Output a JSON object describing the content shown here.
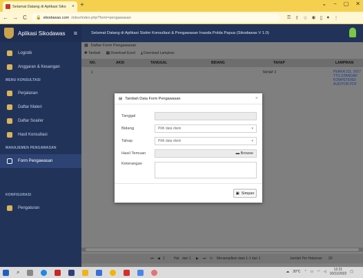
{
  "browser": {
    "tab_title": "Selamat Datang di Aplikasi Siko",
    "tab_close": "×",
    "new_tab": "+",
    "window_controls": [
      "⌄",
      "−",
      "▢",
      "✕"
    ],
    "nav": {
      "back": "←",
      "forward": "→",
      "reload": "C"
    },
    "url_host": "sikodawas.com",
    "url_path": "/sites/index.php?form=pengawasan"
  },
  "app": {
    "brand": "Aplikasi Sikodawas",
    "menu_icon": "≡",
    "header_title": "Selamat Datang di Aplikasi Sistim Konsultasi & Pengawasan Inasda Polda Papua (Sikodawas V 1.0)"
  },
  "sidebar": {
    "items_top": [
      {
        "label": "Logistik",
        "icon": "box-icon"
      },
      {
        "label": "Anggaran & Keuangan",
        "icon": "money-icon"
      }
    ],
    "section1": "MENU KONSULTASI",
    "items_konsultasi": [
      {
        "label": "Perjalanan",
        "icon": "travel-icon"
      },
      {
        "label": "Daftar Materi",
        "icon": "list-icon"
      },
      {
        "label": "Daftar Soal/er",
        "icon": "table-icon"
      },
      {
        "label": "Hasil Konsultasi",
        "icon": "result-icon"
      }
    ],
    "section2": "MANAJEMEN PENGAWASAN",
    "items_pengawasan": [
      {
        "label": "Form Pengawasan",
        "icon": "form-icon",
        "active": true
      }
    ],
    "section3": "KONFIGURASI",
    "items_konfig": [
      {
        "label": "Pengaturan",
        "icon": "settings-icon"
      }
    ]
  },
  "panel": {
    "title": "Daftar Form Pengawasan",
    "toolbar": {
      "tambah": "Tambah",
      "excel": "Download Excel",
      "lampiran": "Download Lampiran"
    },
    "columns": [
      "NO.",
      "AKSI",
      "TANGGAL",
      "BIDANG",
      "TAHAP",
      "LAMPIRAN"
    ],
    "rows": [
      {
        "no": "1",
        "tahap": "TAHAP 2",
        "lampiran": "PERKA 211. 2017 TTG STANDAR KOMPETENSI AUDITOR.PDF"
      }
    ],
    "pager": {
      "page_label": "Hal",
      "page": "1",
      "of_label": "dari 1",
      "showing": "Menampilkan data 1-1 dari 1",
      "per_page_label": "Jumlah Per Halaman",
      "per_page": "20"
    }
  },
  "modal": {
    "title": "Tambah Data Form Pengawasan",
    "close": "×",
    "fields": {
      "tanggal": {
        "label": "Tanggal",
        "value": ""
      },
      "bidang": {
        "label": "Bidang",
        "value": "Pilih data disini"
      },
      "tahap": {
        "label": "Tahap",
        "value": "Pilih data disini"
      },
      "hasil": {
        "label": "Hasil Temuan",
        "button": "Browse"
      },
      "keterangan": {
        "label": "Keterangan",
        "value": ""
      }
    },
    "save": "Simpan"
  },
  "taskbar": {
    "temperature": "30°C",
    "time": "12:21",
    "date": "10/11/2022"
  },
  "colors": {
    "chrome": "#f5d04f",
    "sidebar": "#22335a",
    "overlay": "#7f7f7f"
  }
}
